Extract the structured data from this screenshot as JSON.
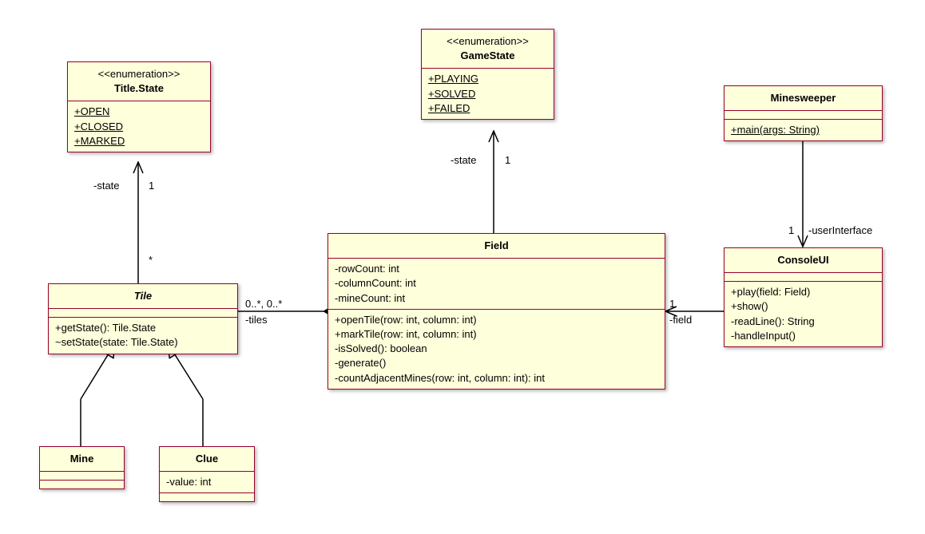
{
  "titleState": {
    "stereotype": "<<enumeration>>",
    "name": "Title.State",
    "literals": [
      "+OPEN",
      "+CLOSED",
      "+MARKED"
    ]
  },
  "gameState": {
    "stereotype": "<<enumeration>>",
    "name": "GameState",
    "literals": [
      "+PLAYING",
      "+SOLVED",
      "+FAILED"
    ]
  },
  "minesweeper": {
    "name": "Minesweeper",
    "ops": [
      "+main(args: String)"
    ]
  },
  "consoleUI": {
    "name": "ConsoleUI",
    "ops": [
      "+play(field: Field)",
      "+show()",
      "-readLine(): String",
      "-handleInput()"
    ]
  },
  "field": {
    "name": "Field",
    "attrs": [
      "-rowCount: int",
      "-columnCount: int",
      "-mineCount: int"
    ],
    "ops": [
      "+openTile(row: int, column: int)",
      "+markTile(row: int, column: int)",
      "-isSolved(): boolean",
      "-generate()",
      "-countAdjacentMines(row: int, column: int): int"
    ]
  },
  "tile": {
    "name": "Tile",
    "ops": [
      "+getState(): Tile.State",
      "~setState(state: Tile.State)"
    ]
  },
  "mine": {
    "name": "Mine"
  },
  "clue": {
    "name": "Clue",
    "attrs": [
      "-value: int"
    ]
  },
  "labels": {
    "stateTile": "-state",
    "stateField": "-state",
    "tiles": "-tiles",
    "field": "-field",
    "userInterface": "-userInterface",
    "one1": "1",
    "one2": "1",
    "one3": "1",
    "one4": "1",
    "star": "*",
    "tilesMult": "0..*, 0..*"
  }
}
